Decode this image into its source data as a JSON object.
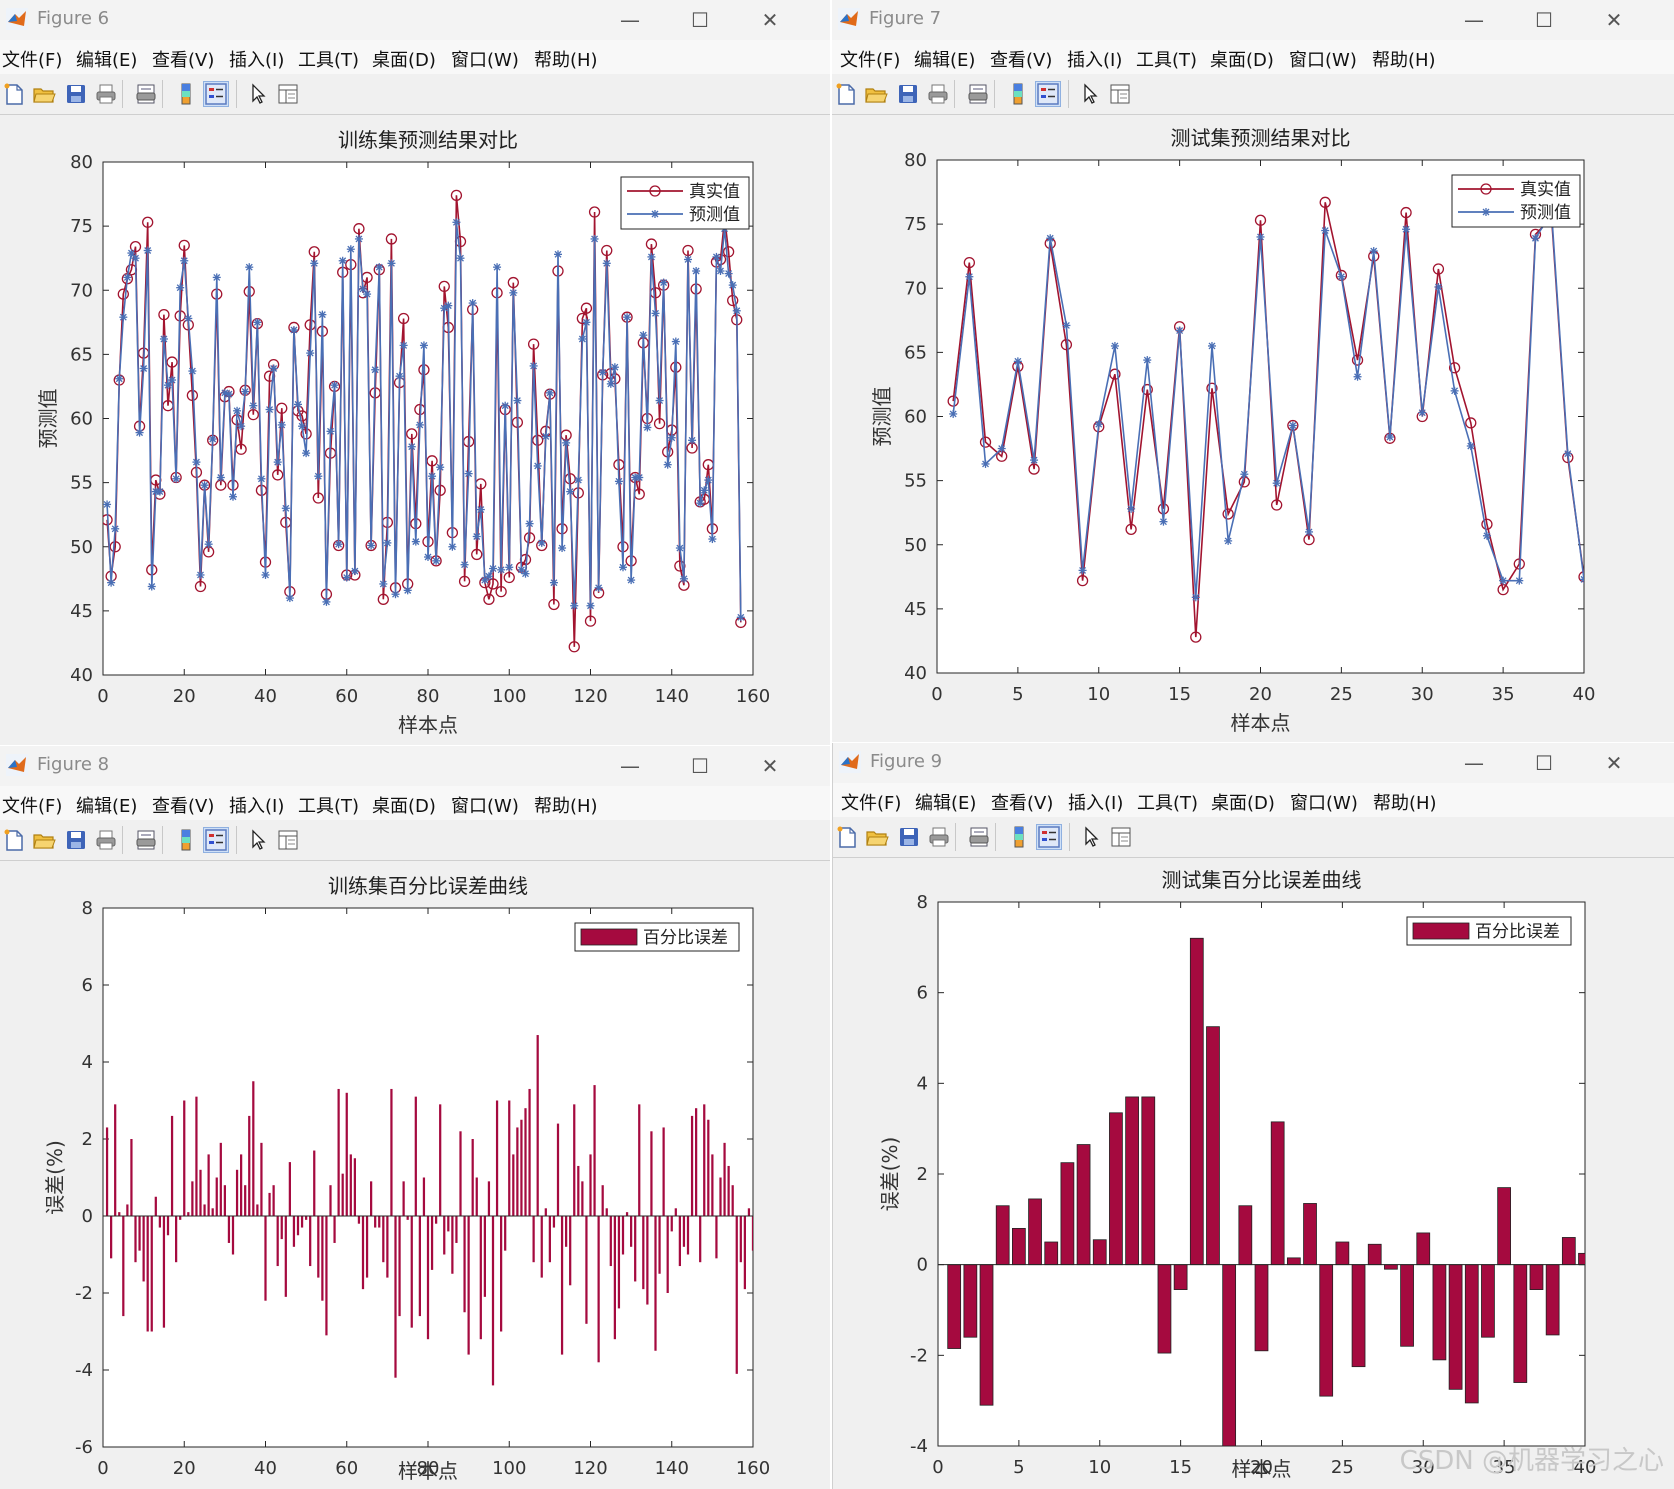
{
  "menu": [
    "文件(F)",
    "编辑(E)",
    "查看(V)",
    "插入(I)",
    "工具(T)",
    "桌面(D)",
    "窗口(W)",
    "帮助(H)"
  ],
  "tools": [
    "new-file-icon",
    "open-folder-icon",
    "save-icon",
    "print-icon",
    "print-preview-icon",
    "colorbar-icon",
    "legend-icon",
    "pointer-icon",
    "property-editor-icon"
  ],
  "colors": {
    "true_line": "#a2142f",
    "pred_line": "#4a6fb5",
    "bar": "#a50a3f",
    "titlebar_text": "#8a8a8a"
  },
  "watermark": "CSDN @机器学习之心",
  "windows": [
    {
      "title": "Figure 6",
      "controls": [
        "—",
        "☐",
        "✕"
      ]
    },
    {
      "title": "Figure 7",
      "controls": [
        "—",
        "☐",
        "✕"
      ]
    },
    {
      "title": "Figure 8",
      "controls": [
        "—",
        "☐",
        "✕"
      ]
    },
    {
      "title": "Figure 9",
      "controls": [
        "—",
        "☐",
        "✕"
      ]
    }
  ],
  "chart_data": [
    {
      "type": "line",
      "title": "训练集预测结果对比",
      "xlabel": "样本点",
      "ylabel": "预测值",
      "xlim": [
        0,
        160
      ],
      "ylim": [
        40,
        80
      ],
      "xticks": [
        "0",
        "20",
        "40",
        "60",
        "80",
        "100",
        "120",
        "140",
        "160"
      ],
      "yticks": [
        "40",
        "45",
        "50",
        "55",
        "60",
        "65",
        "70",
        "75",
        "80"
      ],
      "legend": "top-right",
      "series": [
        {
          "name": "真实值",
          "marker": "circle",
          "values": [
            52.1,
            47.7,
            50,
            63,
            69.7,
            70.9,
            71.6,
            73.4,
            59.4,
            65.1,
            75.3,
            48.2,
            55.2,
            54.1,
            68.1,
            61,
            64.4,
            55.4,
            68,
            73.5,
            67.3,
            61.8,
            55.8,
            46.9,
            54.8,
            49.6,
            58.3,
            69.7,
            54.8,
            61.7,
            62.1,
            54.8,
            59.9,
            57.6,
            62.2,
            69.9,
            60.3,
            67.4,
            54.4,
            48.8,
            63.3,
            64.2,
            55.6,
            60.8,
            51.9,
            46.5,
            67.1,
            60.6,
            60.2,
            58.8,
            67.3,
            73,
            53.8,
            66.8,
            46.3,
            57.3,
            62.5,
            50.1,
            71.4,
            47.8,
            72,
            47.8,
            74.8,
            69.8,
            71,
            50.1,
            62,
            71.6,
            45.9,
            51.9,
            74,
            46.8,
            62.8,
            67.8,
            47.1,
            58.8,
            51.8,
            60.7,
            63.8,
            50.4,
            56.7,
            48.9,
            54.4,
            70.3,
            67.1,
            51.1,
            77.4,
            73.8,
            47.3,
            58.2,
            68.5,
            49.4,
            54.9,
            47.2,
            45.9,
            47.1,
            69.8,
            46.5,
            60.7,
            47.6,
            70.6,
            59.7,
            48.4,
            49,
            50.7,
            65.8,
            58.3,
            50.1,
            59,
            61.9,
            45.5,
            71.5,
            51.4,
            58.7,
            55.3,
            42.2,
            54.2,
            67.8,
            68.6,
            44.2,
            76.1,
            46.4,
            63.4,
            73.1,
            63.5,
            63.1,
            56.4,
            50,
            67.9,
            48.9,
            55.4,
            54.1,
            65.9,
            60,
            73.6,
            69.8,
            59.6,
            70.4,
            57.4,
            59.1,
            64,
            48.5,
            47,
            73.1,
            57.7,
            70.1,
            53.5,
            53.7,
            56.4,
            51.4,
            72.2,
            72.4,
            75.6,
            73,
            69.2,
            67.7,
            44.1
          ]
        },
        {
          "name": "预测值",
          "marker": "asterisk",
          "values": [
            53.3,
            47.2,
            51.4,
            63.1,
            67.9,
            71,
            72.9,
            72.5,
            58.9,
            63.9,
            73.1,
            46.9,
            54.3,
            54.3,
            66.2,
            62.6,
            63,
            55.3,
            70.2,
            72.3,
            67.8,
            63.7,
            56.6,
            47.8,
            54.8,
            50.2,
            58.4,
            71,
            55.4,
            62,
            61.9,
            53.9,
            60.6,
            59.4,
            62.1,
            71.8,
            61,
            67.5,
            55.3,
            47.8,
            60.7,
            63.9,
            56.6,
            59.5,
            53,
            46,
            66.9,
            61.1,
            59.4,
            57.3,
            65.1,
            72.1,
            55.5,
            68.1,
            45.7,
            59,
            62.6,
            50.2,
            72.3,
            47.6,
            73.2,
            48.1,
            74,
            70.1,
            69.7,
            50.1,
            63.8,
            71.8,
            47.1,
            50.3,
            72.1,
            46.3,
            63.3,
            65.7,
            46.6,
            57.8,
            50.4,
            59.5,
            65.7,
            49.2,
            55.5,
            48.9,
            56.2,
            68.6,
            68.8,
            50,
            75.3,
            72.5,
            48.6,
            55.7,
            69,
            50.8,
            52.9,
            47.4,
            47.7,
            48.3,
            71.8,
            48.2,
            61,
            48.4,
            69.8,
            61.4,
            48.2,
            47.9,
            51.8,
            64.1,
            56.3,
            50.3,
            58.6,
            62,
            47.2,
            72.8,
            49.9,
            58.1,
            54.3,
            45.4,
            55.2,
            66.2,
            67.5,
            45.4,
            74,
            46.8,
            63.6,
            72.1,
            62.7,
            64,
            55.1,
            48.4,
            67.9,
            47.4,
            55.4,
            55.4,
            66.5,
            59.3,
            72.6,
            68.2,
            61.4,
            70.6,
            56.4,
            58.5,
            66,
            49.9,
            47.5,
            72.4,
            58.3,
            71.5,
            53.4,
            54.4,
            55.2,
            50.6,
            72.6,
            71.5,
            74.8,
            71.3,
            70.4,
            68.4,
            44.5
          ]
        }
      ]
    },
    {
      "type": "line",
      "title": "测试集预测结果对比",
      "xlabel": "样本点",
      "ylabel": "预测值",
      "xlim": [
        0,
        40
      ],
      "ylim": [
        40,
        80
      ],
      "xticks": [
        "0",
        "5",
        "10",
        "15",
        "20",
        "25",
        "30",
        "35",
        "40"
      ],
      "yticks": [
        "40",
        "45",
        "50",
        "55",
        "60",
        "65",
        "70",
        "75",
        "80"
      ],
      "legend": "top-right",
      "series": [
        {
          "name": "真实值",
          "marker": "circle",
          "values": [
            61.2,
            72,
            58,
            56.9,
            63.9,
            55.9,
            73.5,
            65.6,
            47.2,
            59.2,
            63.3,
            51.2,
            62.1,
            52.8,
            67,
            42.8,
            62.2,
            52.4,
            54.9,
            75.3,
            53.1,
            59.3,
            50.4,
            76.7,
            71,
            64.4,
            72.5,
            58.3,
            75.9,
            60,
            71.5,
            63.8,
            59.5,
            51.6,
            46.5,
            48.5,
            74.2,
            75.5,
            56.8,
            47.5
          ]
        },
        {
          "name": "预测值",
          "marker": "asterisk",
          "values": [
            60.2,
            70.9,
            56.3,
            57.5,
            64.3,
            56.6,
            73.9,
            67.1,
            48,
            59.4,
            65.5,
            52.8,
            64.4,
            51.8,
            66.7,
            45.9,
            65.5,
            50.3,
            55.5,
            74,
            54.8,
            59.3,
            51,
            74.5,
            70.9,
            63.1,
            72.9,
            58.4,
            74.6,
            60.3,
            70.1,
            62,
            57.7,
            50.7,
            47.2,
            47.2,
            73.9,
            75.9,
            57.1,
            47.3
          ]
        }
      ]
    },
    {
      "type": "bar",
      "title": "训练集百分比误差曲线",
      "xlabel": "样本点",
      "ylabel": "误差(%)",
      "xlim": [
        0,
        160
      ],
      "ylim": [
        -6,
        8
      ],
      "xticks": [
        "0",
        "20",
        "40",
        "60",
        "80",
        "100",
        "120",
        "140",
        "160"
      ],
      "yticks": [
        "-6",
        "-4",
        "-2",
        "0",
        "2",
        "4",
        "6",
        "8"
      ],
      "legend": "top-right",
      "series": [
        {
          "name": "百分比误差",
          "values": [
            2.3,
            -1.1,
            2.9,
            0.1,
            -2.6,
            0.3,
            2.0,
            -1.2,
            -0.9,
            -1.7,
            -3.0,
            -3.0,
            0.5,
            -0.3,
            -2.9,
            -0.5,
            2.6,
            -1.2,
            -0.1,
            3.0,
            0.1,
            0.9,
            3.1,
            1.2,
            0.3,
            1.6,
            0.2,
            1.0,
            1.9,
            0.8,
            -0.7,
            -1.0,
            1.2,
            1.6,
            0.8,
            2.6,
            3.5,
            0.3,
            1.9,
            -2.2,
            0.6,
            0.8,
            -1.3,
            -0.6,
            -2.1,
            1.4,
            -0.8,
            -0.5,
            -0.3,
            -0.1,
            -1.3,
            1.7,
            -1.6,
            -2.2,
            -3.1,
            0.8,
            -0.7,
            3.3,
            1.1,
            3.2,
            1.6,
            1.5,
            -0.2,
            -1.9,
            -1.6,
            0.9,
            -0.3,
            -0.3,
            -1.2,
            -1.6,
            3.3,
            -4.2,
            -2.6,
            0.9,
            -0.1,
            -2.9,
            3.1,
            -2.6,
            1.0,
            -3.2,
            -1.4,
            -0.2,
            2.9,
            -1.0,
            -0.4,
            -1.5,
            -0.7,
            2.2,
            -2.5,
            -3.6,
            2.0,
            1.0,
            -3.2,
            -2.1,
            0.9,
            -4.4,
            3.0,
            -3.0,
            -0.9,
            3.0,
            1.6,
            2.3,
            2.5,
            2.8,
            3.3,
            -1.2,
            4.7,
            -1.6,
            0.2,
            -1.2,
            -0.3,
            2.4,
            -3.6,
            -0.8,
            -1.8,
            2.9,
            1.3,
            0.9,
            -2.8,
            1.6,
            3.4,
            -3.8,
            0.8,
            0.2,
            -1.3,
            -3.2,
            -2.4,
            -1.0,
            0.1,
            -0.8,
            -1.7,
            2.9,
            -1.9,
            -2.3,
            2.2,
            -3.5,
            -1.5,
            2.3,
            -2.0,
            -0.4,
            0.2,
            -1.3,
            -0.8,
            -1.0,
            2.6,
            2.8,
            -1.2,
            2.9,
            2.5,
            1.6,
            -1.1,
            1.0,
            1.9,
            1.3,
            0.8,
            -4.1,
            -1.2,
            -1.9,
            0.2,
            -0.9,
            1.5,
            0.8,
            1.1
          ]
        }
      ]
    },
    {
      "type": "bar",
      "title": "测试集百分比误差曲线",
      "xlabel": "样本点",
      "ylabel": "误差(%)",
      "xlim": [
        0,
        40
      ],
      "ylim": [
        -4,
        8
      ],
      "xticks": [
        "0",
        "5",
        "10",
        "15",
        "20",
        "25",
        "30",
        "35",
        "40"
      ],
      "yticks": [
        "-4",
        "-2",
        "0",
        "2",
        "4",
        "6",
        "8"
      ],
      "legend": "top-right",
      "series": [
        {
          "name": "百分比误差",
          "values": [
            -1.85,
            -1.6,
            -3.1,
            1.3,
            0.8,
            1.45,
            0.5,
            2.25,
            2.65,
            0.55,
            3.35,
            3.7,
            3.7,
            -1.95,
            -0.55,
            7.2,
            5.25,
            -4.0,
            1.3,
            -1.9,
            3.15,
            0.15,
            1.35,
            -2.9,
            0.5,
            -2.25,
            0.45,
            -0.1,
            -1.8,
            0.7,
            -2.1,
            -2.75,
            -3.05,
            -1.6,
            1.7,
            -2.6,
            -0.55,
            -1.55,
            0.6,
            0.25
          ]
        }
      ]
    }
  ]
}
